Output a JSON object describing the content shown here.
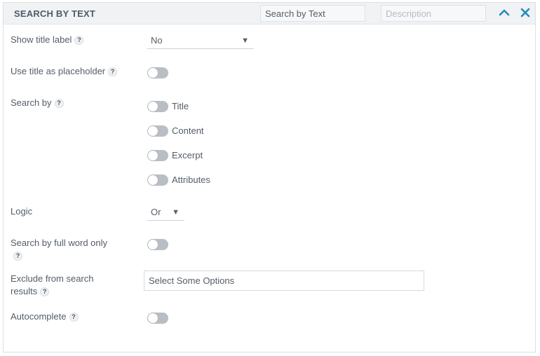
{
  "header": {
    "title": "SEARCH BY TEXT",
    "name_value": "Search by Text",
    "description_placeholder": "Description"
  },
  "fields": {
    "show_title_label": {
      "label": "Show title label",
      "value": "No",
      "help": "?"
    },
    "use_title_placeholder": {
      "label": "Use title as placeholder",
      "help": "?",
      "enabled": false
    },
    "search_by": {
      "label": "Search by",
      "help": "?",
      "options": [
        {
          "label": "Title",
          "enabled": false
        },
        {
          "label": "Content",
          "enabled": false
        },
        {
          "label": "Excerpt",
          "enabled": false
        },
        {
          "label": "Attributes",
          "enabled": false
        }
      ]
    },
    "logic": {
      "label": "Logic",
      "value": "Or"
    },
    "full_word": {
      "label_line1": "Search by full word only",
      "help": "?",
      "enabled": false
    },
    "exclude": {
      "label_line1": "Exclude from search",
      "label_line2": "results",
      "help": "?",
      "placeholder": "Select Some Options"
    },
    "autocomplete": {
      "label": "Autocomplete",
      "help": "?",
      "enabled": false
    }
  },
  "icons": {
    "collapse": "chevron-up-icon",
    "close": "close-icon"
  },
  "colors": {
    "accent": "#1e8cbe",
    "toggle_off": "#b9bec4"
  }
}
